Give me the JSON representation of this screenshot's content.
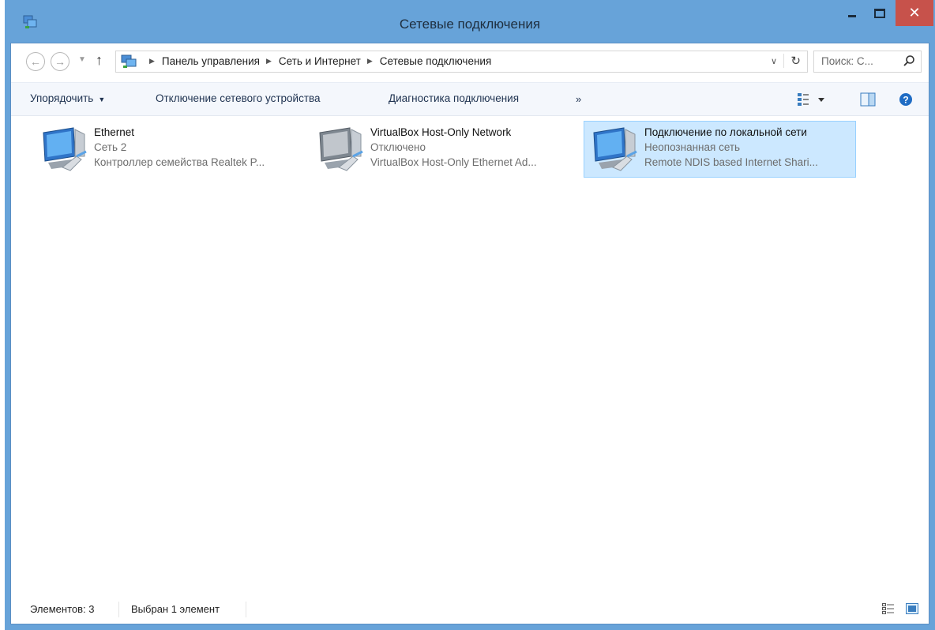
{
  "window": {
    "title": "Сетевые подключения",
    "close_label": "✕"
  },
  "address": {
    "crumbs": [
      "Панель управления",
      "Сеть и Интернет",
      "Сетевые подключения"
    ],
    "search_placeholder": "Поиск: С..."
  },
  "toolbar": {
    "organize": "Упорядочить",
    "disable": "Отключение сетевого устройства",
    "diagnose": "Диагностика подключения",
    "more": "»"
  },
  "connections": [
    {
      "name": "Ethernet",
      "status": "Сеть  2",
      "device": "Контроллер семейства Realtek P...",
      "selected": false
    },
    {
      "name": "VirtualBox Host-Only Network",
      "status": "Отключено",
      "device": "VirtualBox Host-Only Ethernet Ad...",
      "selected": false
    },
    {
      "name": "Подключение по локальной сети",
      "status": "Неопознанная сеть",
      "device": "Remote NDIS based Internet Shari...",
      "selected": true
    }
  ],
  "status": {
    "count": "Элементов: 3",
    "selected": "Выбран 1 элемент"
  },
  "colors": {
    "frame": "#67a3d9",
    "close": "#c7524b",
    "selection": "#cce8ff",
    "toolbar_bg": "#f4f7fc"
  },
  "icons": [
    "window-icon",
    "back-arrow-icon",
    "forward-arrow-icon",
    "up-arrow-icon",
    "refresh-icon",
    "search-icon",
    "views-icon",
    "preview-pane-icon",
    "help-icon",
    "network-adapter-icon",
    "details-view-icon",
    "tiles-view-icon"
  ]
}
